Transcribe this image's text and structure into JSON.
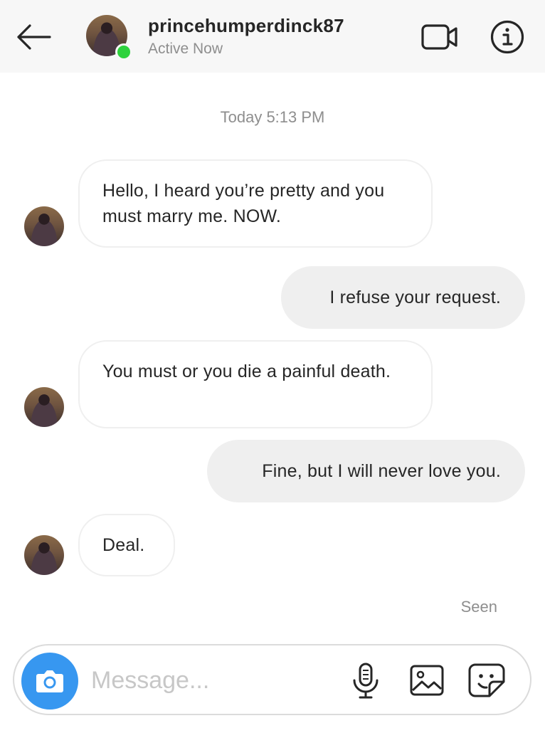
{
  "header": {
    "username": "princehumperdinck87",
    "status": "Active Now",
    "icons": {
      "back": "back-arrow-icon",
      "video": "video-camera-icon",
      "info": "info-icon"
    }
  },
  "thread": {
    "timestamp": "Today 5:13 PM",
    "messages": [
      {
        "direction": "incoming",
        "text": "Hello, I heard you’re pretty and you must marry me. NOW."
      },
      {
        "direction": "outgoing",
        "text": "I refuse your request."
      },
      {
        "direction": "incoming",
        "text": "You must or you die a painful death."
      },
      {
        "direction": "outgoing",
        "text": "Fine, but I will never love you."
      },
      {
        "direction": "incoming",
        "text": "Deal."
      }
    ],
    "seen_label": "Seen"
  },
  "composer": {
    "placeholder": "Message...",
    "icons": {
      "camera": "camera-icon",
      "mic": "microphone-icon",
      "gallery": "image-gallery-icon",
      "sticker": "sticker-icon"
    }
  },
  "colors": {
    "online": "#2ed23d",
    "camera_button": "#3797f0",
    "outgoing_bubble": "#efefef",
    "secondary_text": "#8e8e8e"
  }
}
